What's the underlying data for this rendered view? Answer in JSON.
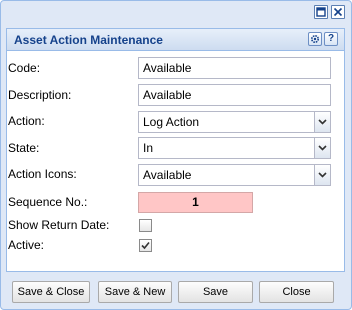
{
  "panel": {
    "title": "Asset Action Maintenance"
  },
  "form": {
    "code_label": "Code:",
    "code_value": "Available",
    "description_label": "Description:",
    "description_value": "Available",
    "action_label": "Action:",
    "action_value": "Log Action",
    "state_label": "State:",
    "state_value": "In",
    "action_icons_label": "Action Icons:",
    "action_icons_value": "Available",
    "sequence_label": "Sequence No.:",
    "sequence_value": "1",
    "show_return_date_label": "Show Return Date:",
    "show_return_date_checked": false,
    "active_label": "Active:",
    "active_checked": true
  },
  "buttons": {
    "save_close": "Save & Close",
    "save_new": "Save & New",
    "save": "Save",
    "close": "Close"
  },
  "colors": {
    "window_bg": "#dfe8f6",
    "border": "#99bbe8",
    "title_text": "#15428b",
    "required_field_bg": "#ffc6c6"
  },
  "icons": {
    "maximize": "maximize-icon",
    "close": "close-icon",
    "gear": "gear-icon",
    "help": "help-icon",
    "dropdown": "chevron-down-icon",
    "checkmark": "checkmark-icon"
  }
}
